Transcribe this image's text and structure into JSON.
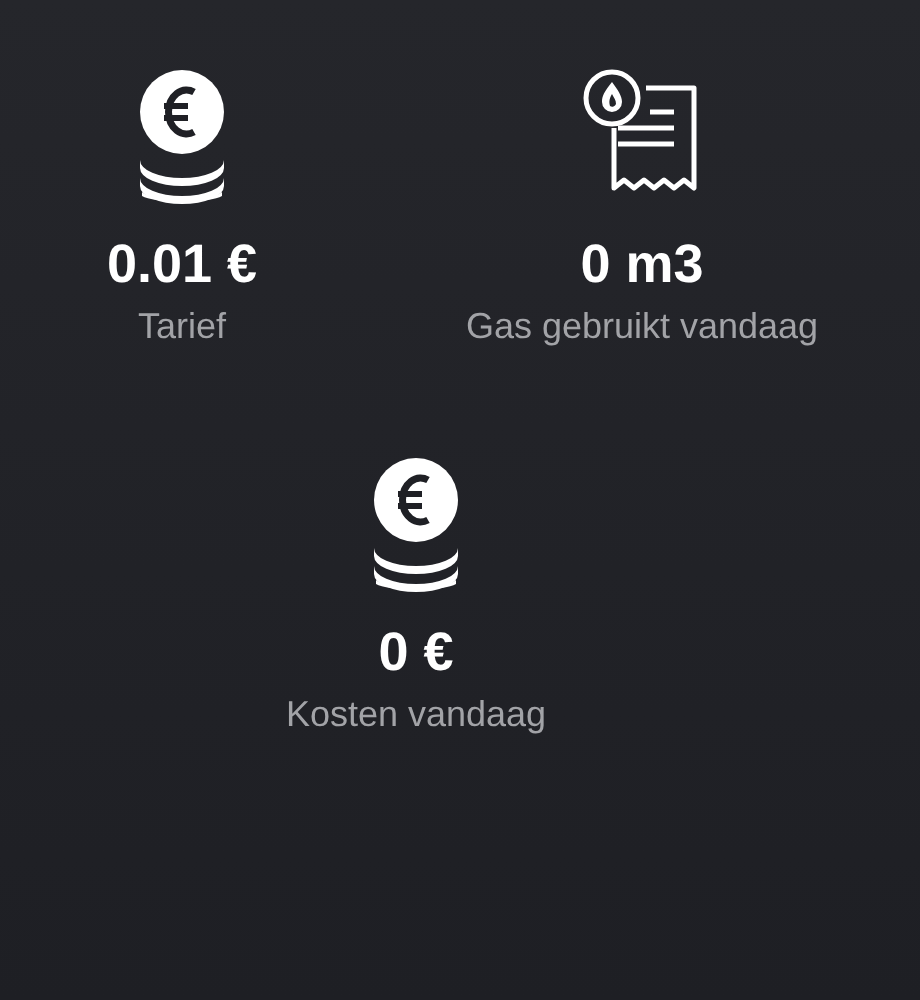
{
  "tiles": [
    {
      "kind": "coins",
      "value": "0.01 €",
      "label": "Tarief"
    },
    {
      "kind": "gas-receipt",
      "value": "0 m3",
      "label": "Gas gebruikt vandaag"
    },
    {
      "kind": "coins",
      "value": "0 €",
      "label": "Kosten vandaag"
    }
  ]
}
